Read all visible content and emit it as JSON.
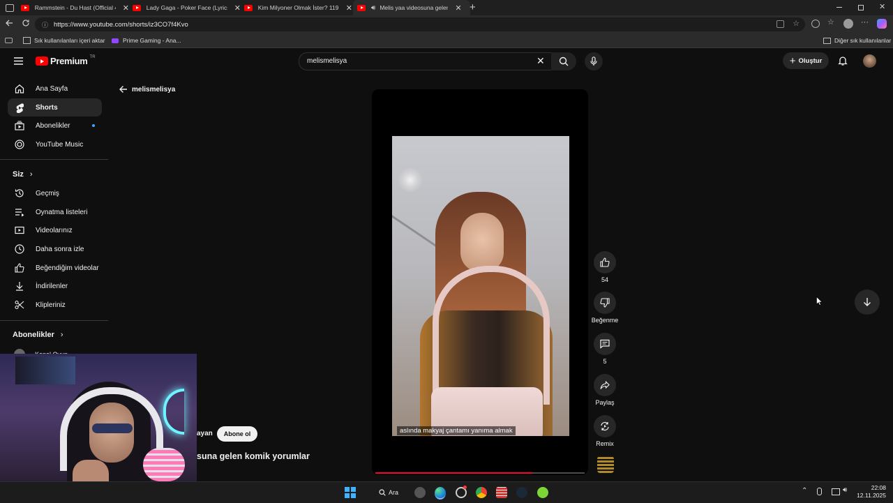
{
  "browser": {
    "tabs": [
      {
        "label": "Rammstein - Du Hast (Official 4K"
      },
      {
        "label": "Lady Gaga - Poker Face (Lyrics) - "
      },
      {
        "label": "Kim Milyoner Olmak İster? 1191. "
      },
      {
        "label": "Melis yaa videosuna gelen k"
      }
    ],
    "url": "https://www.youtube.com/shorts/iz3CO7f4Kvo",
    "bookmarks": [
      {
        "label": "Sık kullanılanları içeri aktar"
      },
      {
        "label": "Prime Gaming - Ana..."
      }
    ],
    "other_bookmarks": "Diğer sık kullanılanlar"
  },
  "youtube": {
    "brand": "Premium",
    "region": "TR",
    "search_value": "melismelisya",
    "create_label": "Oluştur",
    "back_channel": "melismelisya",
    "nav": [
      {
        "label": "Ana Sayfa",
        "icon": "home-icon"
      },
      {
        "label": "Shorts",
        "icon": "shorts-icon"
      },
      {
        "label": "Abonelikler",
        "icon": "subscriptions-icon"
      },
      {
        "label": "YouTube Music",
        "icon": "music-icon"
      }
    ],
    "you_heading": "Siz",
    "you_items": [
      {
        "label": "Geçmiş",
        "icon": "history-icon"
      },
      {
        "label": "Oynatma listeleri",
        "icon": "playlists-icon"
      },
      {
        "label": "Videolarınız",
        "icon": "your-videos-icon"
      },
      {
        "label": "Daha sonra izle",
        "icon": "watch-later-icon"
      },
      {
        "label": "Beğendiğim videolar",
        "icon": "liked-icon"
      },
      {
        "label": "İndirilenler",
        "icon": "downloads-icon"
      },
      {
        "label": "Klipleriniz",
        "icon": "clips-icon"
      }
    ],
    "subs_heading": "Abonelikler",
    "subs_partial": "Kanal Oyun",
    "short": {
      "caption": "aslında makyaj çantamı yanıma almak",
      "channel_fragment": "ayan",
      "subscribe_label": "Abone ol",
      "title_fragment": "suna gelen komik yorumlar",
      "progress": 0.75
    },
    "actions": {
      "like_count": "54",
      "dislike_label": "Beğenme",
      "comments_count": "5",
      "share_label": "Paylaş",
      "remix_label": "Remix"
    }
  },
  "taskbar": {
    "search_label": "Ara",
    "time": "22:08",
    "date": "12.11.2025"
  }
}
